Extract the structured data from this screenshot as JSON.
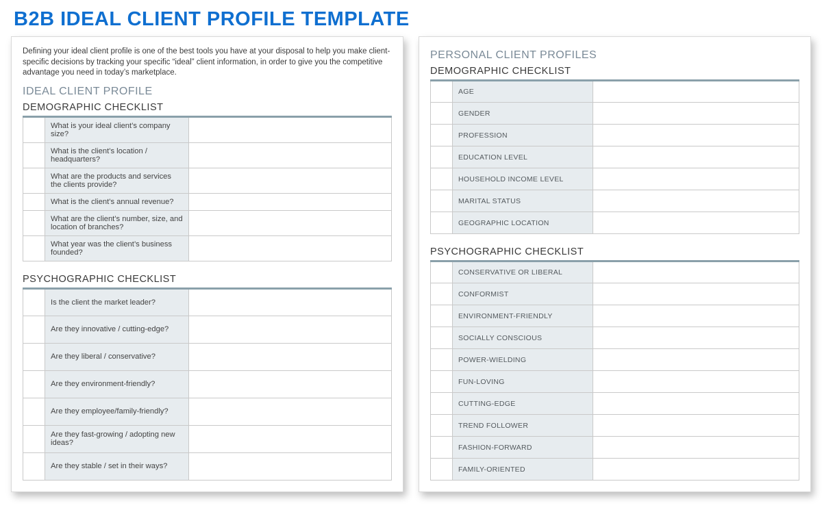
{
  "title": "B2B IDEAL CLIENT PROFILE TEMPLATE",
  "left": {
    "intro": "Defining your ideal client profile is one of the best tools you have at your disposal to help you make client-specific decisions by tracking your specific “ideal” client information, in order to give you the competitive advantage you need in today’s marketplace.",
    "section": "IDEAL CLIENT PROFILE",
    "demo_heading": "DEMOGRAPHIC CHECKLIST",
    "demo_items": [
      "What is your ideal client’s company size?",
      "What is the client’s location / headquarters?",
      "What are the products and services the clients provide?",
      "What is the client’s annual revenue?",
      "What are the client’s number, size, and location of branches?",
      "What year was the client’s business founded?"
    ],
    "psy_heading": "PSYCHOGRAPHIC CHECKLIST",
    "psy_items": [
      "Is the client the market leader?",
      "Are they innovative / cutting-edge?",
      "Are they liberal / conservative?",
      "Are they environment-friendly?",
      "Are they employee/family-friendly?",
      "Are they fast-growing / adopting new ideas?",
      "Are they stable / set in their ways?"
    ]
  },
  "right": {
    "section": "PERSONAL CLIENT PROFILES",
    "demo_heading": "DEMOGRAPHIC CHECKLIST",
    "demo_items": [
      "AGE",
      "GENDER",
      "PROFESSION",
      "EDUCATION LEVEL",
      "HOUSEHOLD INCOME LEVEL",
      "MARITAL STATUS",
      "GEOGRAPHIC LOCATION"
    ],
    "psy_heading": "PSYCHOGRAPHIC CHECKLIST",
    "psy_items": [
      "CONSERVATIVE OR LIBERAL",
      "CONFORMIST",
      "ENVIRONMENT-FRIENDLY",
      "SOCIALLY CONSCIOUS",
      "POWER-WIELDING",
      "FUN-LOVING",
      "CUTTING-EDGE",
      "TREND FOLLOWER",
      "FASHION-FORWARD",
      "FAMILY-ORIENTED"
    ]
  }
}
